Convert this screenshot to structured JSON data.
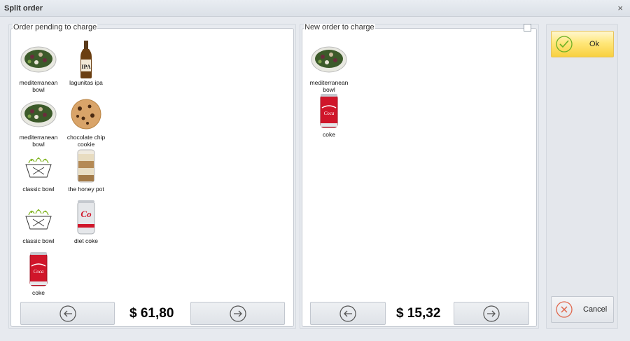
{
  "window": {
    "title": "Split order",
    "close_symbol": "×"
  },
  "left_panel": {
    "legend": "Order pending to charge",
    "total": "$ 61,80",
    "items": [
      {
        "label": "mediterranean\nbowl",
        "icon": "bowl-salad-icon"
      },
      {
        "label": "lagunitas ipa",
        "icon": "beer-bottle-icon"
      },
      {
        "label": "mediterranean\nbowl",
        "icon": "bowl-salad-icon"
      },
      {
        "label": "chocolate chip\ncookie",
        "icon": "cookie-icon"
      },
      {
        "label": "classic bowl",
        "icon": "bowl-outline-icon"
      },
      {
        "label": "the honey pot",
        "icon": "jar-icon"
      },
      {
        "label": "classic bowl",
        "icon": "bowl-outline-icon"
      },
      {
        "label": "diet coke",
        "icon": "diet-coke-can-icon"
      },
      {
        "label": "coke",
        "icon": "coke-can-icon"
      }
    ]
  },
  "right_panel": {
    "legend": "New order to charge",
    "total": "$ 15,32",
    "items": [
      {
        "label": "mediterranean\nbowl",
        "icon": "bowl-salad-icon"
      },
      {
        "label": "coke",
        "icon": "coke-can-icon"
      }
    ]
  },
  "actions": {
    "ok_label": "Ok",
    "cancel_label": "Cancel"
  },
  "colors": {
    "ok_accent": "#f8d040",
    "ok_check": "#6bb024",
    "cancel_x": "#e0674c",
    "coke_red": "#d0162a"
  }
}
